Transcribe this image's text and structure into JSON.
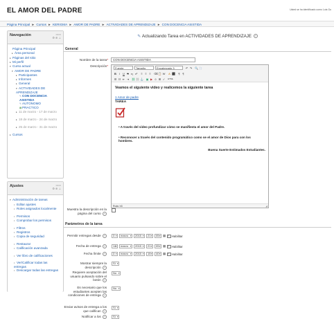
{
  "header": {
    "site_title": "EL AMOR DEL PADRE",
    "login_info": "Usted se ha identificado como Luis Gu"
  },
  "breadcrumb": [
    "Página Principal",
    "Cursos",
    "KERIGMA",
    "AMOR DE PADRE",
    "ACTIVIDADES DE APRENDIZAJE",
    "CON DOCENCIA ASISTIDA"
  ],
  "breadcrumb_sep": "►",
  "navigation": {
    "title": "Navegación",
    "items": [
      {
        "label": "Página Principal",
        "level": 0,
        "arrow": ""
      },
      {
        "label": "Área personal",
        "level": 1,
        "arrow": "▸"
      },
      {
        "label": "Páginas del sitio",
        "level": 0,
        "arrow": "▸"
      },
      {
        "label": "Mi perfil",
        "level": 0,
        "arrow": "▸"
      },
      {
        "label": "Curso actual",
        "level": 0,
        "arrow": "▾"
      },
      {
        "label": "AMOR DE PADRE",
        "level": 1,
        "arrow": "▾"
      },
      {
        "label": "Participantes",
        "level": 2,
        "arrow": "▸"
      },
      {
        "label": "Informes",
        "level": 2,
        "arrow": "▸"
      },
      {
        "label": "General",
        "level": 2,
        "arrow": "▸"
      },
      {
        "label": "ACTIVIDADES DE APRENDIZAJE",
        "level": 2,
        "arrow": "▾"
      },
      {
        "label": "CON DOCENCIA ASISTIDA",
        "level": 3,
        "arrow": ""
      },
      {
        "label": "AUTONOMO",
        "level": 3,
        "arrow": ""
      },
      {
        "label": "PRACTICO",
        "level": 3,
        "arrow": ""
      },
      {
        "label": "11 de marzo - 17 de marzo",
        "level": 2,
        "arrow": "▸"
      },
      {
        "label": "18 de marzo - 24 de marzo",
        "level": 2,
        "arrow": "▸"
      },
      {
        "label": "25 de marzo - 31 de marzo",
        "level": 2,
        "arrow": "▸"
      },
      {
        "label": "Cursos",
        "level": 0,
        "arrow": "▸"
      }
    ]
  },
  "settings": {
    "title": "Ajustes",
    "section": "Administración de tareas",
    "items": [
      "Editar ajustes",
      "Roles asignados localmente",
      "Permisos",
      "Comprobar los permisos",
      "Filtros",
      "Registros",
      "Copia de seguridad",
      "Restaurar",
      "Calificación avanzada",
      "Ver libro de calificaciones",
      "Ver/Calificar todas las entregas",
      "Descargar todas las entregas"
    ]
  },
  "main": {
    "page_heading": "Actualizando Tarea en ACTIVIDADES DE APRENDIZAJE",
    "general_label": "General",
    "task_name_label": "Nombre de la tarea",
    "task_name_value": "CON DOCENCIA ASISTIDA",
    "description_label": "Descripción",
    "editor": {
      "font_select": "Fuente",
      "size_select": "Tamaño",
      "paragraph_select": "Encabezado 3",
      "heading_text": "Veamos el siguiente video y realicemos la siguiente tarea",
      "link_text": "1 Amor de padre",
      "task_label": "TAREA",
      "bullets": [
        "A través del video profundizar cómo se manifiesta el amor del Padre.",
        "Reconocer a través del contenido programático como se el amor de Dios para con los hombres."
      ],
      "closing": "Buena Suerte Estimados Estudiantes.",
      "path": "Ruta: h3"
    },
    "show_description_label": "Muestra la descripción en la página del curso",
    "params_label": "Parámetros de la tarea",
    "allow_from": {
      "label": "Permitir entregas desde",
      "day": "3",
      "month": "marzo",
      "year": "2015",
      "hour": "21",
      "min": "05",
      "enable": "Habilitar"
    },
    "due_date": {
      "label": "Fecha de entrega",
      "day": "14",
      "month": "marzo",
      "year": "2015",
      "hour": "21",
      "min": "05",
      "enable": "Habilitar"
    },
    "cutoff": {
      "label": "Fecha límite",
      "day": "3",
      "month": "marzo",
      "year": "2015",
      "hour": "15",
      "min": "40",
      "enable": "Habilitar"
    },
    "always_show": {
      "label": "Mostrar siempre la descripción",
      "value": "Sí"
    },
    "require_accept": {
      "label": "Requiere aceptación del usuario pulsando sobre el botón",
      "value": "No"
    },
    "must_accept": {
      "label": "Es necesario que los estudiantes acepten las condiciones de entrega",
      "value": "No"
    },
    "notify_graders": {
      "label": "Enviar avisos de entrega a los que califican",
      "value": "Sí"
    },
    "notify_late": {
      "label": "Notificar a los",
      "value": "Sí"
    }
  },
  "colors": {
    "link": "#1a5fb4",
    "required": "#cc0000"
  }
}
